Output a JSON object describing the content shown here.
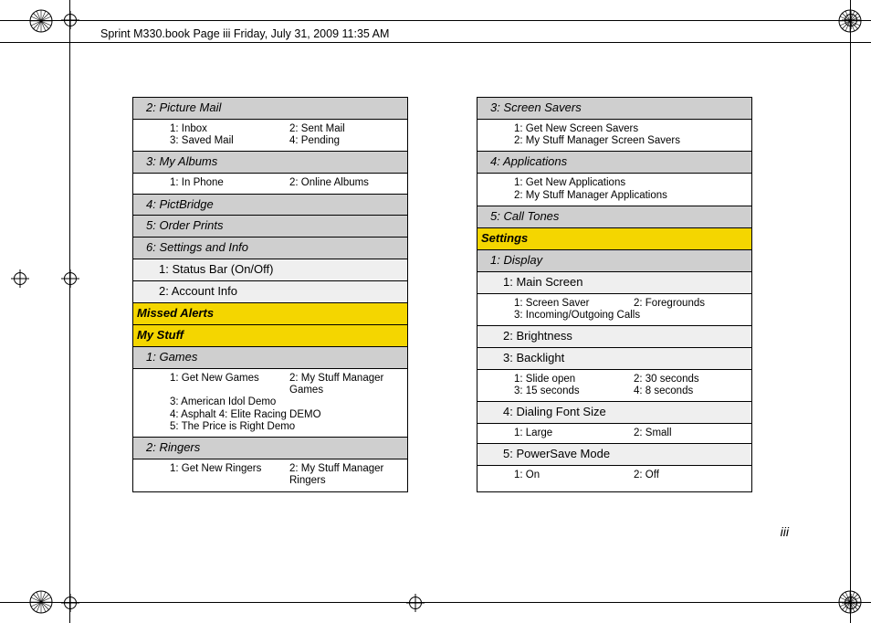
{
  "header": "Sprint M330.book  Page iii  Friday, July 31, 2009  11:35 AM",
  "page_number": "iii",
  "left": {
    "picture_mail": "2: Picture Mail",
    "picture_mail_items": [
      "1: Inbox",
      "2: Sent Mail",
      "3: Saved Mail",
      "4: Pending"
    ],
    "my_albums": "3: My Albums",
    "my_albums_items": [
      "1: In Phone",
      "2: Online Albums"
    ],
    "pictbridge": "4: PictBridge",
    "order_prints": "5: Order Prints",
    "settings_info": "6: Settings and Info",
    "status_bar": "1: Status Bar (On/Off)",
    "account_info": "2: Account Info",
    "missed_alerts": "Missed Alerts",
    "my_stuff": "My Stuff",
    "games": "1: Games",
    "games_items_l1": "1: Get New Games",
    "games_items_l2": "2: My Stuff Manager Games",
    "games_items_l3": "3: American Idol Demo",
    "games_items_l4": "4: Asphalt 4: Elite Racing DEMO",
    "games_items_l5": "5: The Price is Right Demo",
    "ringers": "2: Ringers",
    "ringers_items": [
      "1: Get New Ringers",
      "2: My Stuff Manager Ringers"
    ]
  },
  "right": {
    "screen_savers": "3: Screen Savers",
    "screen_savers_l1": "1: Get New Screen Savers",
    "screen_savers_l2": "2: My Stuff Manager Screen Savers",
    "applications": "4: Applications",
    "applications_l1": "1: Get New Applications",
    "applications_l2": "2: My Stuff Manager Applications",
    "call_tones": "5: Call Tones",
    "settings": "Settings",
    "display": "1: Display",
    "main_screen": "1: Main Screen",
    "main_screen_items": [
      "1: Screen Saver",
      "2: Foregrounds",
      "3: Incoming/Outgoing Calls"
    ],
    "brightness": "2: Brightness",
    "backlight": "3: Backlight",
    "backlight_items": [
      "1: Slide open",
      "2: 30 seconds",
      "3: 15 seconds",
      "4: 8 seconds"
    ],
    "dialing_font": "4: Dialing Font Size",
    "dialing_font_items": [
      "1: Large",
      "2: Small"
    ],
    "powersave": "5: PowerSave Mode",
    "powersave_items": [
      "1: On",
      "2: Off"
    ]
  }
}
